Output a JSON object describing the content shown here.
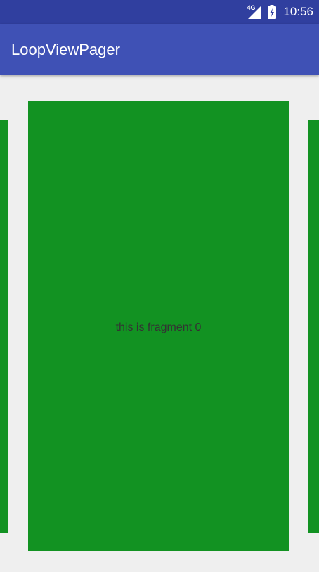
{
  "status_bar": {
    "network": "4G",
    "time": "10:56",
    "icons": [
      "signal-icon",
      "battery-charging-icon"
    ]
  },
  "app_bar": {
    "title": "LoopViewPager"
  },
  "pager": {
    "current_page_text": "this is fragment 0",
    "page_color": "#129222"
  },
  "colors": {
    "status_bar": "#303f9f",
    "app_bar": "#3f51b5",
    "background": "#efefef"
  }
}
